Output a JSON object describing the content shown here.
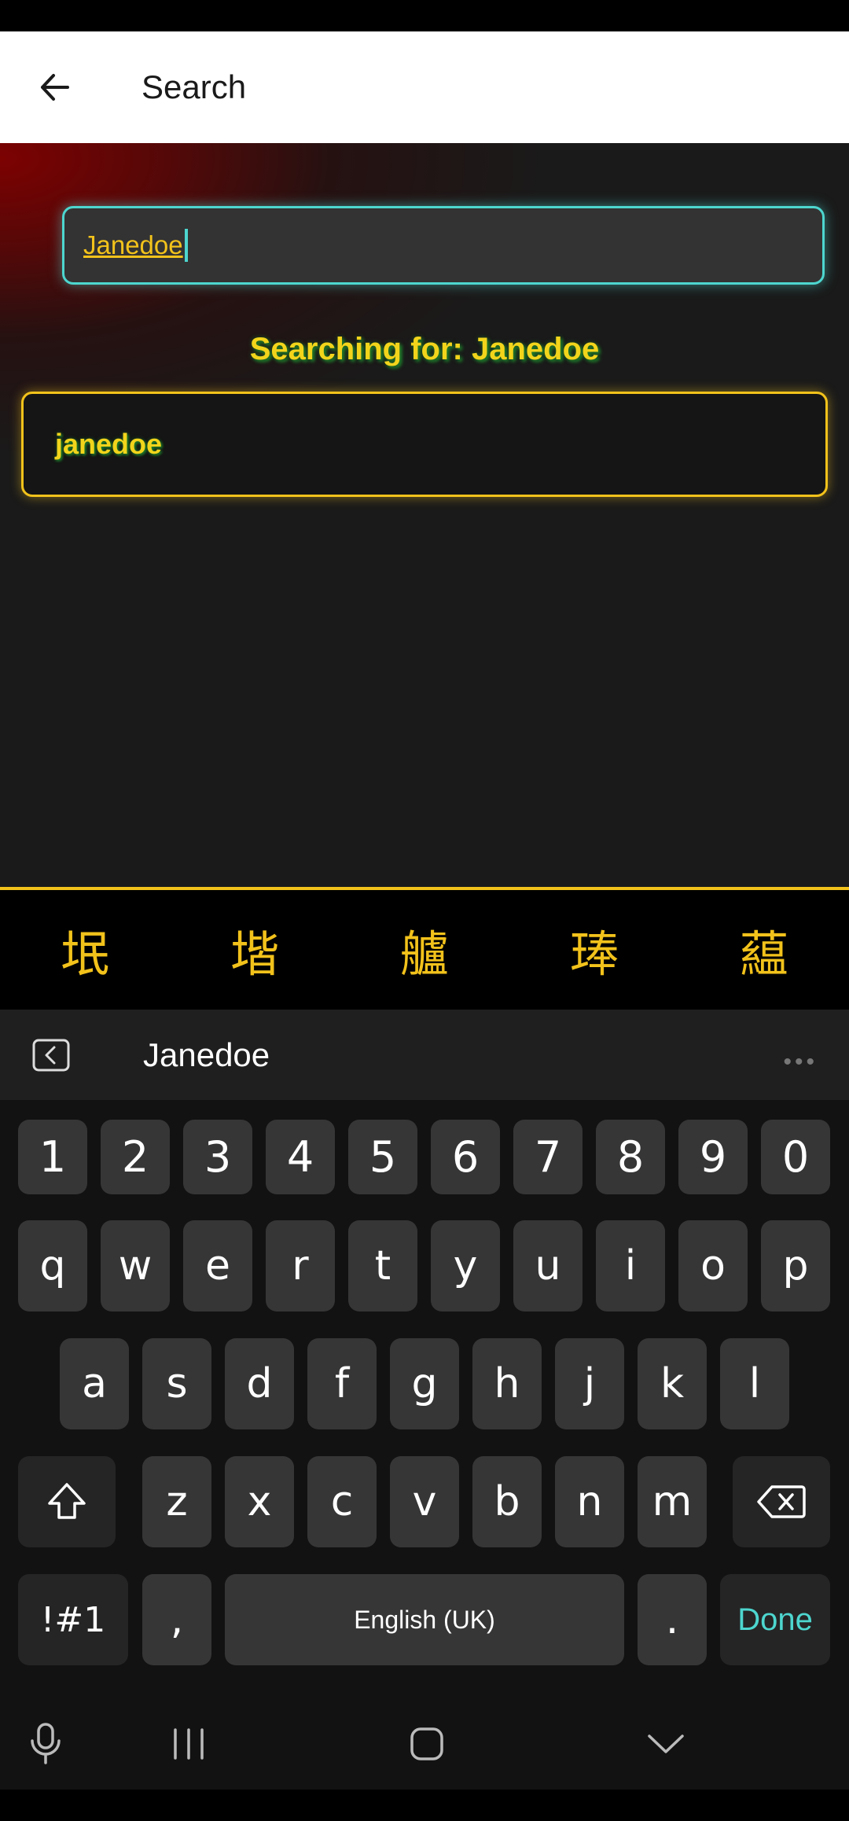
{
  "app_bar": {
    "title": "Search"
  },
  "search": {
    "value": "Janedoe",
    "status_prefix": "Searching for:",
    "status_value": "Janedoe"
  },
  "results": [
    {
      "label": "janedoe"
    }
  ],
  "accent_colors": {
    "cyan": "#4dd6cf",
    "yellow": "#f2c21b",
    "green_shadow": "#1e7e2a"
  },
  "glyph_candidates": [
    "垊",
    "堦",
    "艫",
    "琫",
    "藴"
  ],
  "keyboard": {
    "suggestion": "Janedoe",
    "number_row": [
      "1",
      "2",
      "3",
      "4",
      "5",
      "6",
      "7",
      "8",
      "9",
      "0"
    ],
    "row1": [
      "q",
      "w",
      "e",
      "r",
      "t",
      "y",
      "u",
      "i",
      "o",
      "p"
    ],
    "row2": [
      "a",
      "s",
      "d",
      "f",
      "g",
      "h",
      "j",
      "k",
      "l"
    ],
    "row3": [
      "z",
      "x",
      "c",
      "v",
      "b",
      "n",
      "m"
    ],
    "symbols_label": "!#1",
    "comma_label": ",",
    "space_label": "English (UK)",
    "period_label": ".",
    "done_label": "Done"
  },
  "icons": [
    "back-arrow-icon",
    "keyboard-back-icon",
    "more-dots-icon",
    "shift-icon",
    "backspace-icon",
    "mic-icon",
    "recents-icon",
    "home-icon",
    "hide-keyboard-icon"
  ]
}
